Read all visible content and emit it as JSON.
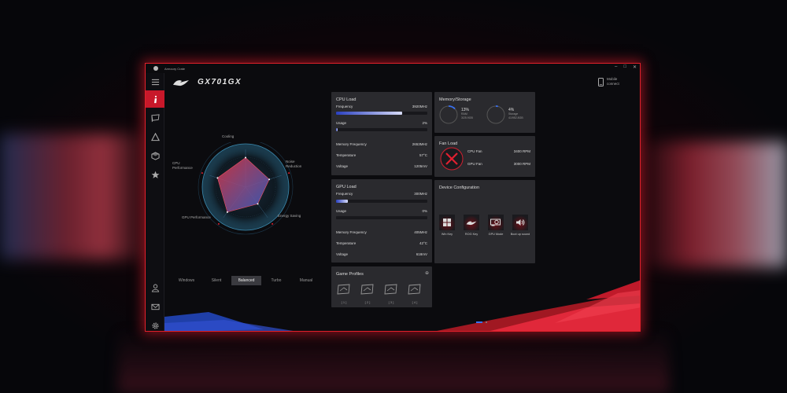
{
  "app": {
    "title": "Armoury Crate",
    "model": "GX701GX",
    "mobile_connect": "Mobile connect"
  },
  "sidebar": {
    "items": [
      {
        "name": "menu",
        "icon": "hamburger-menu-icon"
      },
      {
        "name": "home",
        "icon": "info-icon"
      },
      {
        "name": "system",
        "icon": "flag-icon"
      },
      {
        "name": "aura",
        "icon": "triangle-icon"
      },
      {
        "name": "device",
        "icon": "box-icon"
      },
      {
        "name": "featured",
        "icon": "star-icon"
      },
      {
        "name": "user",
        "icon": "user-icon"
      },
      {
        "name": "news",
        "icon": "mail-icon"
      },
      {
        "name": "settings",
        "icon": "gear-icon"
      }
    ]
  },
  "radar": {
    "labels": {
      "cooling": "Cooling",
      "noise_reduction": "Noise Reduction",
      "energy_saving": "Energy Saving",
      "gpu_performance": "GPU Performance",
      "cpu_performance": "CPU Performance"
    },
    "levels": {
      "cooling": 0.78,
      "noise_reduction": 0.66,
      "energy_saving": 0.55,
      "gpu_performance": 0.82,
      "cpu_performance": 0.78
    }
  },
  "modes": {
    "items": [
      "Windows",
      "Silent",
      "Balanced",
      "Turbo",
      "Manual"
    ],
    "selected": "Balanced"
  },
  "cpu": {
    "title": "CPU Load",
    "frequency_label": "Frequency",
    "frequency": "3920MHz",
    "frequency_fraction": 0.72,
    "usage_label": "Usage",
    "usage": "2%",
    "usage_fraction": 0.02,
    "mem_freq_label": "Memory Frequency",
    "mem_freq": "2653MHz",
    "temp_label": "Temperature",
    "temp": "57°C",
    "voltage_label": "Voltage",
    "voltage": "1205mV"
  },
  "gpu": {
    "title": "GPU Load",
    "frequency_label": "Frequency",
    "frequency": "300MHz",
    "frequency_fraction": 0.13,
    "usage_label": "Usage",
    "usage": "0%",
    "usage_fraction": 0.0,
    "mem_freq_label": "Memory Frequency",
    "mem_freq": "405MHz",
    "temp_label": "Temperature",
    "temp": "42°C",
    "voltage_label": "Voltage",
    "voltage": "618mV"
  },
  "memory": {
    "title": "Memory/Storage",
    "ram_pct": "13%",
    "ram_label": "RAM",
    "ram_detail": "3/25.9GB",
    "ram_fraction": 0.13,
    "storage_pct": "4%",
    "storage_label": "Storage",
    "storage_detail": "41/952.8GB",
    "storage_fraction": 0.04
  },
  "fan": {
    "title": "Fan Load",
    "cpu_label": "CPU Fan",
    "cpu_rpm": "3400 RPM",
    "gpu_label": "GPU Fan",
    "gpu_rpm": "3000 RPM"
  },
  "device": {
    "title": "Device Configuration",
    "items": [
      {
        "label": "Win Key",
        "icon": "windows-key-icon"
      },
      {
        "label": "ROG Key",
        "icon": "rog-key-icon"
      },
      {
        "label": "GPU Mode",
        "icon": "gpu-card-icon"
      },
      {
        "label": "Boot up sound",
        "icon": "speaker-icon"
      }
    ]
  },
  "profiles": {
    "title": "Game Profiles",
    "slots": [
      "[ 1 ]",
      "[ 2 ]",
      "[ 3 ]",
      "[ 4 ]"
    ]
  },
  "colors": {
    "accent": "#e0202a",
    "bar": "#2a40c0",
    "card": "#2a2a2e"
  }
}
